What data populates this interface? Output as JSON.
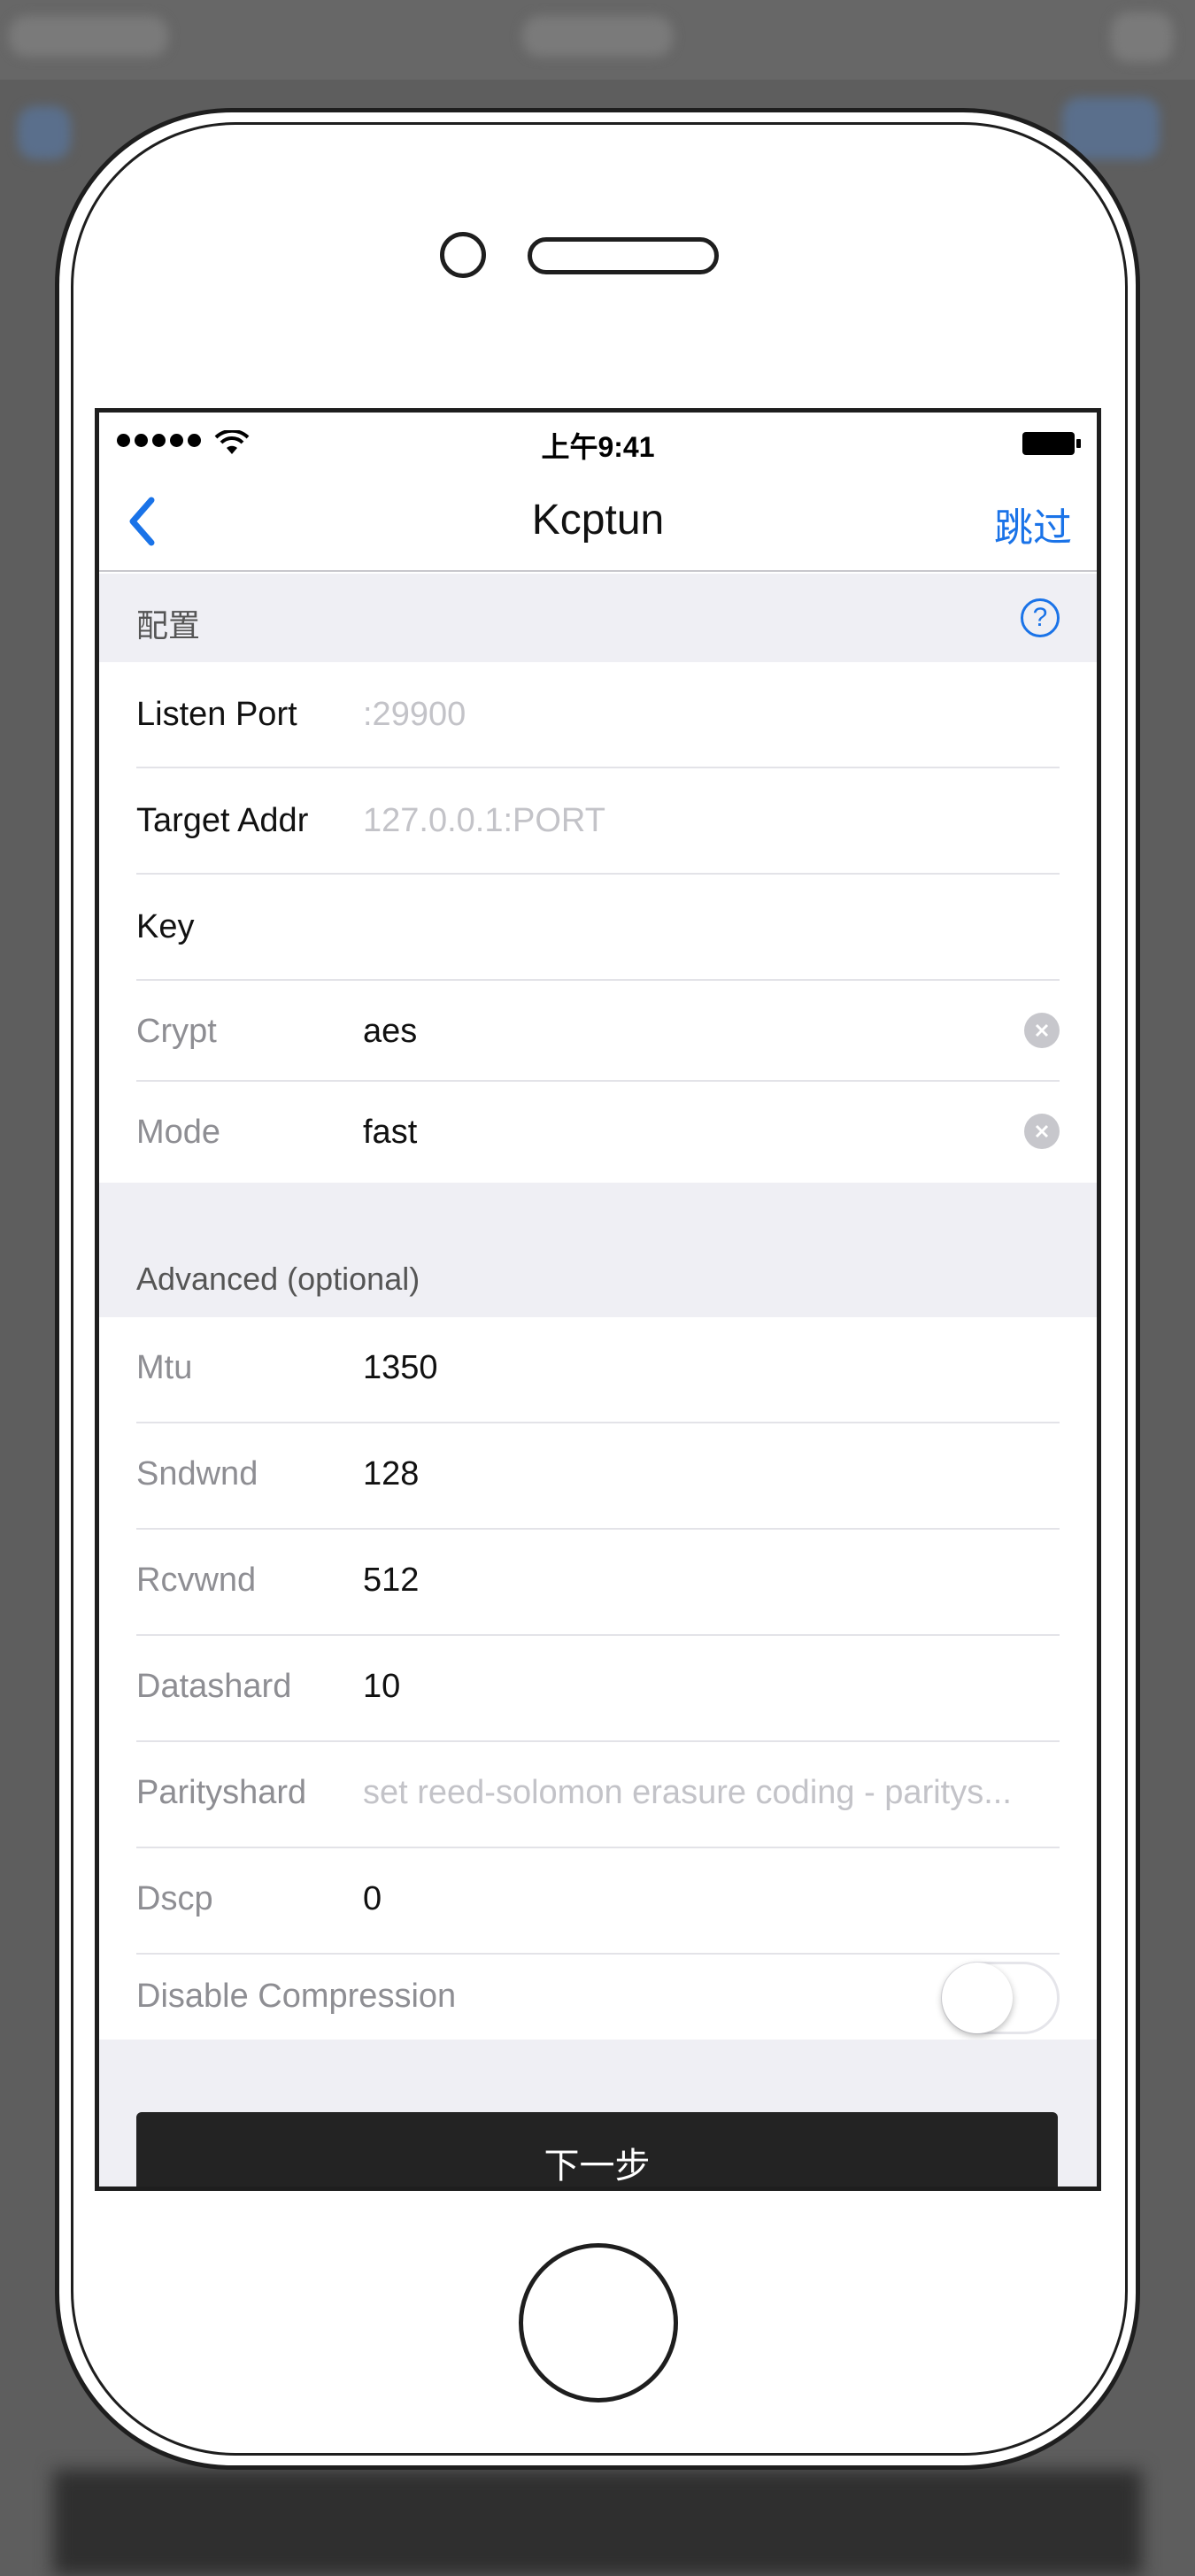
{
  "status_bar": {
    "time": "上午9:41"
  },
  "nav": {
    "title": "Kcptun",
    "skip_label": "跳过"
  },
  "config_section": {
    "title": "配置"
  },
  "config_rows": [
    {
      "label": "Listen Port",
      "value": "",
      "placeholder": ":29900"
    },
    {
      "label": "Target Addr",
      "value": "",
      "placeholder": "127.0.0.1:PORT"
    },
    {
      "label": "Key",
      "value": "",
      "placeholder": ""
    },
    {
      "label": "Crypt",
      "value": "aes",
      "placeholder": ""
    },
    {
      "label": "Mode",
      "value": "fast",
      "placeholder": ""
    }
  ],
  "advanced_section": {
    "title": "Advanced (optional)"
  },
  "advanced_rows": [
    {
      "label": "Mtu",
      "value": "1350",
      "placeholder": ""
    },
    {
      "label": "Sndwnd",
      "value": "128",
      "placeholder": ""
    },
    {
      "label": "Rcvwnd",
      "value": "512",
      "placeholder": ""
    },
    {
      "label": "Datashard",
      "value": "10",
      "placeholder": ""
    },
    {
      "label": "Parityshard",
      "value": "",
      "placeholder": "set reed-solomon erasure coding - paritys..."
    },
    {
      "label": "Dscp",
      "value": "0",
      "placeholder": ""
    }
  ],
  "compression": {
    "label": "Disable Compression",
    "enabled": false
  },
  "next_button": {
    "label": "下一步"
  },
  "colors": {
    "accent": "#1a73e8",
    "section_bg": "#efeff4",
    "button_bg": "#232323"
  },
  "icons": {
    "back": "chevron-left-icon",
    "help": "question-circle-icon",
    "clear": "clear-circle-icon",
    "wifi": "wifi-icon",
    "battery": "battery-icon"
  }
}
